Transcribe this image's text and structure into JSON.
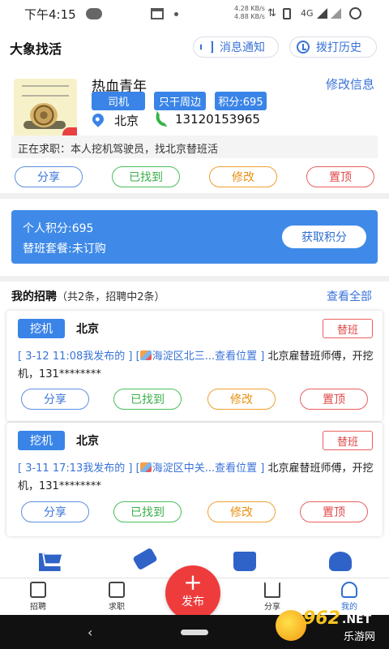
{
  "status_bar": {
    "time": "下午4:15",
    "speed_up": "4.28 KB/s",
    "speed_down": "4.88 KB/s",
    "network": "4G"
  },
  "header": {
    "title": "大象找活",
    "notify_label": "消息通知",
    "history_label": "拨打历史"
  },
  "profile": {
    "name": "热血青年",
    "edit_label": "修改信息",
    "tags": [
      "司机",
      "只干周边",
      "积分:695"
    ],
    "city": "北京",
    "phone": "13120153965",
    "seeking": "正在求职：本人挖机驾驶员，找北京替班活",
    "actions": [
      "分享",
      "已找到",
      "修改",
      "置顶"
    ]
  },
  "points": {
    "personal": "个人积分:695",
    "plan": "替班套餐:未订购",
    "earn_label": "获取积分"
  },
  "recruitment": {
    "title": "我的招聘",
    "count": "（共2条，招聘中2条）",
    "view_all": "查看全部",
    "jobs": [
      {
        "tag": "挖机",
        "city": "北京",
        "badge": "替班",
        "link": "[ 3-12 11:08我发布的 ] [",
        "location": "海淀区北三...查看位置 ]",
        "desc": " 北京雇替班师傅，开挖机，131********",
        "actions": [
          "分享",
          "已找到",
          "修改",
          "置顶"
        ]
      },
      {
        "tag": "挖机",
        "city": "北京",
        "badge": "替班",
        "link": "[ 3-11 17:13我发布的 ] [",
        "location": "海淀区中关...查看位置 ]",
        "desc": " 北京雇替班师傅，开挖机，131********",
        "actions": [
          "分享",
          "已找到",
          "修改",
          "置顶"
        ]
      }
    ]
  },
  "bottom_nav": {
    "items": [
      "招聘",
      "求职",
      "分享",
      "我的"
    ],
    "publish": "发布",
    "publish_symbol": "+"
  },
  "watermark": {
    "number": "962",
    "net": ".NET",
    "text": "乐游网"
  },
  "colors": {
    "accent": "#3a84e8",
    "danger": "#e04848",
    "success": "#3aae49",
    "warning": "#e89010"
  }
}
